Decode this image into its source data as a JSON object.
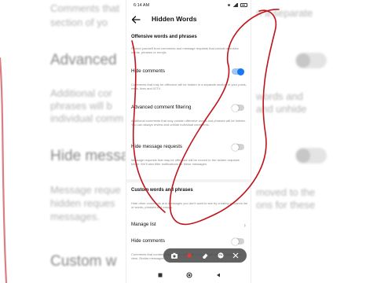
{
  "status_bar": {
    "time": "6:14 AM"
  },
  "header": {
    "title": "Hidden Words"
  },
  "offensive": {
    "title": "Offensive words and phrases",
    "description": "Protect yourself from comments and message requests that contain offensive words, phrases or emojis.",
    "hide_comments": {
      "label": "Hide comments",
      "enabled": true,
      "description": "Comments that may be offensive will be hidden in a separate section of your posts, reels, lives and IGTV."
    },
    "advanced_filtering": {
      "label": "Advanced comment filtering",
      "enabled": false,
      "description": "Additional comments that may contain offensive words and phrases will be hidden. You can always review and unhide individual comments."
    },
    "hide_requests": {
      "label": "Hide message requests",
      "enabled": false,
      "description": "Message requests that may be offensive will be moved to the hidden requests folder. We'll also filter notifications for these messages."
    }
  },
  "custom": {
    "title": "Custom words and phrases",
    "description": "Hide other comments and messages you don't want to see by creating a custom list of words, phrases and emojis.",
    "manage_list": {
      "label": "Manage list"
    },
    "hide_comments": {
      "label": "Hide comments",
      "enabled": false,
      "description": "Comments that contain these words, phrases or emojis will also be hidden from view. Similar messages..."
    }
  },
  "background": {
    "left_lines": [
      "Comments that",
      "section of yo",
      "Advanced",
      "Additional cor",
      "phrases will b",
      "individual comm",
      "Hide messa",
      "Message reque",
      "hidden reques",
      "messages.",
      "Custom w"
    ],
    "right_lines": [
      "n a separate",
      "words and",
      "and unhide",
      "moved to the",
      "ons for these"
    ]
  },
  "colors": {
    "accent": "#1877f2",
    "annotation": "#c0141a"
  }
}
